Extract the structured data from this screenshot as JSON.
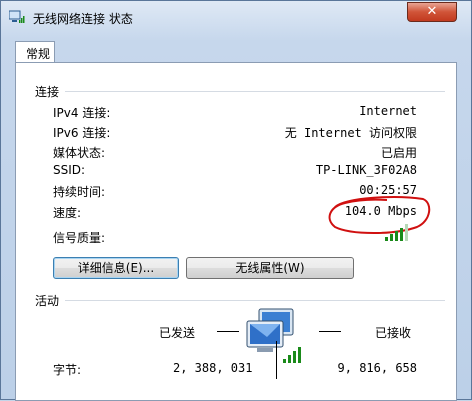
{
  "window": {
    "title": "无线网络连接 状态",
    "close_label": "✕"
  },
  "tabs": [
    {
      "label": "常规"
    }
  ],
  "connection": {
    "group_title": "连接",
    "rows": [
      {
        "label": "IPv4 连接:",
        "value": "Internet"
      },
      {
        "label": "IPv6 连接:",
        "value": "无 Internet 访问权限"
      },
      {
        "label": "媒体状态:",
        "value": "已启用"
      },
      {
        "label": "SSID:",
        "value": "TP-LINK_3F02A8"
      },
      {
        "label": "持续时间:",
        "value": "00:25:57"
      },
      {
        "label": "速度:",
        "value": "104.0 Mbps"
      }
    ],
    "signal_label": "信号质量:",
    "signal_bars_lit": 4,
    "signal_bars_total": 5
  },
  "buttons": {
    "details": "详细信息(E)...",
    "wireless_props": "无线属性(W)"
  },
  "activity": {
    "group_title": "活动",
    "sent_label": "已发送",
    "received_label": "已接收",
    "bytes_label": "字节:",
    "bytes_sent": "2, 388, 031",
    "bytes_received": "9, 816, 658"
  },
  "colors": {
    "signal_green": "#1a8a1a",
    "annotation_red": "#d01010",
    "close_red": "#c23a1f"
  },
  "icons": {
    "title": "wireless-network-icon",
    "activity": "network-computers-icon"
  }
}
